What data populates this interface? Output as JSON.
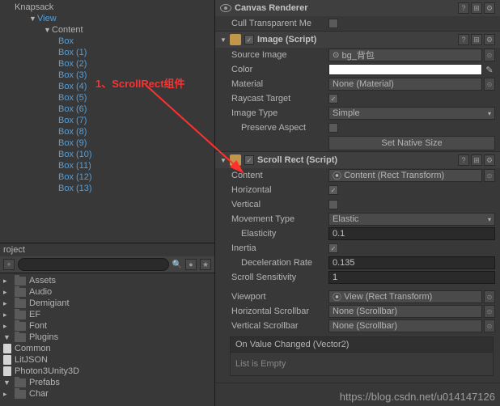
{
  "hierarchy": {
    "root": "Knapsack",
    "view": "View",
    "content": "Content",
    "boxes": [
      "Box",
      "Box (1)",
      "Box (2)",
      "Box (3)",
      "Box (4)",
      "Box (5)",
      "Box (6)",
      "Box (7)",
      "Box (8)",
      "Box (9)",
      "Box (10)",
      "Box (11)",
      "Box (12)",
      "Box (13)"
    ]
  },
  "project": {
    "title": "roject",
    "search_placeholder": "",
    "assets_label": "Assets",
    "folders": [
      "Audio",
      "Demigiant",
      "EF",
      "Font",
      "Plugins"
    ],
    "plugin_files": [
      "Common",
      "LitJSON",
      "Photon3Unity3D"
    ],
    "folders2": [
      "Prefabs",
      "Char"
    ]
  },
  "canvas_renderer": {
    "title": "Canvas Renderer",
    "cull_label": "Cull Transparent Me"
  },
  "image_comp": {
    "title": "Image (Script)",
    "source_label": "Source Image",
    "source_value": "bg_背包",
    "color_label": "Color",
    "material_label": "Material",
    "material_value": "None (Material)",
    "raycast_label": "Raycast Target",
    "imagetype_label": "Image Type",
    "imagetype_value": "Simple",
    "preserve_label": "Preserve Aspect",
    "native_btn": "Set Native Size"
  },
  "scrollrect": {
    "title": "Scroll Rect (Script)",
    "content_label": "Content",
    "content_value": "Content (Rect Transform)",
    "horizontal_label": "Horizontal",
    "vertical_label": "Vertical",
    "movement_label": "Movement Type",
    "movement_value": "Elastic",
    "elasticity_label": "Elasticity",
    "elasticity_value": "0.1",
    "inertia_label": "Inertia",
    "decel_label": "Deceleration Rate",
    "decel_value": "0.135",
    "sensitivity_label": "Scroll Sensitivity",
    "sensitivity_value": "1",
    "viewport_label": "Viewport",
    "viewport_value": "View (Rect Transform)",
    "hscroll_label": "Horizontal Scrollbar",
    "hscroll_value": "None (Scrollbar)",
    "vscroll_label": "Vertical Scrollbar",
    "vscroll_value": "None (Scrollbar)",
    "event_title": "On Value Changed (Vector2)",
    "event_empty": "List is Empty"
  },
  "annotation": "1、ScrollRect组件",
  "watermark": "https://blog.csdn.net/u014147126"
}
